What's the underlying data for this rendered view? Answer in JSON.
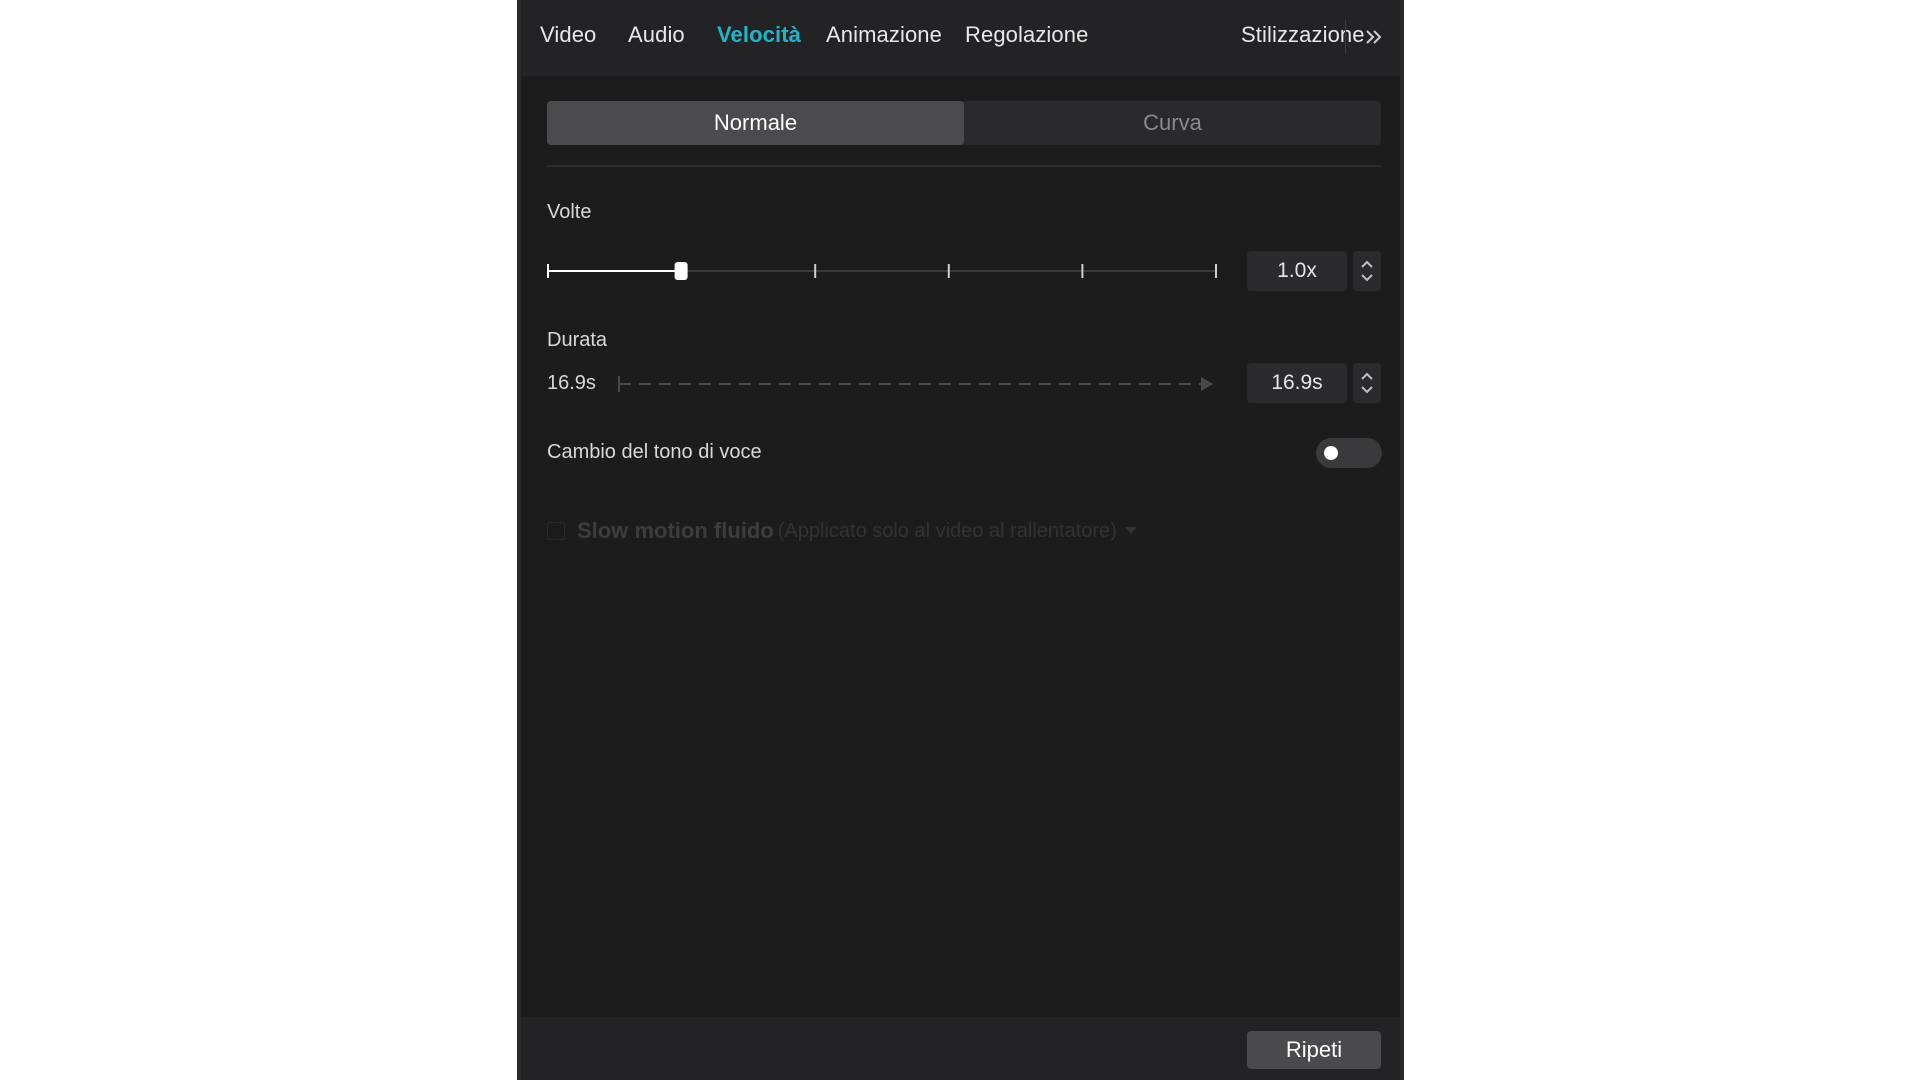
{
  "tabs": [
    {
      "label": "Video",
      "active": false
    },
    {
      "label": "Audio",
      "active": false
    },
    {
      "label": "Velocità",
      "active": true
    },
    {
      "label": "Animazione",
      "active": false
    },
    {
      "label": "Regolazione",
      "active": false
    },
    {
      "label": "Stilizzazione",
      "active": false
    }
  ],
  "more_icon": "double-chevron-right-icon",
  "mode": {
    "options": [
      "Normale",
      "Curva"
    ],
    "selected": "Normale"
  },
  "speed": {
    "label": "Volte",
    "value": "1.0x",
    "slider_position": 0.2,
    "tick_count": 6
  },
  "duration": {
    "label": "Durata",
    "original": "16.9s",
    "value": "16.9s"
  },
  "pitch": {
    "label": "Cambio del tono di voce",
    "enabled": false
  },
  "slow_motion": {
    "label": "Slow motion fluido",
    "note": "(Applicato solo al video al rallentatore)",
    "enabled": false
  },
  "footer": {
    "repeat_label": "Ripeti"
  },
  "colors": {
    "accent": "#21b4c9",
    "panel_bg": "#1c1c1d"
  }
}
